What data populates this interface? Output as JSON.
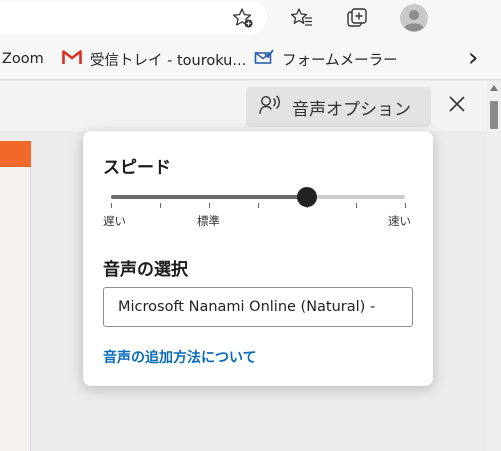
{
  "browser": {
    "toolbar": {
      "icons": [
        "add-to-favorites-icon",
        "favorites-icon",
        "collections-icon",
        "profile-avatar",
        "more-icon"
      ],
      "more_glyph": "⋯"
    },
    "bookmarks": [
      {
        "label": "Zoom",
        "icon": "none"
      },
      {
        "label": "受信トレイ - touroku...",
        "icon": "gmail-icon",
        "color": "#d93025"
      },
      {
        "label": "フォームメーラー",
        "icon": "checkmail-icon",
        "color": "#2b5fa8"
      }
    ],
    "overflow_glyph": "›"
  },
  "reader": {
    "voice_options_label": "音声オプション",
    "close_glyph": "✕"
  },
  "voice_panel": {
    "speed_title": "スピード",
    "speed": {
      "min_label": "遅い",
      "mid_label": "標準",
      "max_label": "速い",
      "value_fraction": 0.667,
      "ticks": 7
    },
    "voice_title": "音声の選択",
    "selected_voice": "Microsoft Nanami Online (Natural) -",
    "add_voices_link": "音声の追加方法について"
  },
  "colors": {
    "accent_link": "#0a6cb8",
    "doc_accent": "#f0692a"
  }
}
